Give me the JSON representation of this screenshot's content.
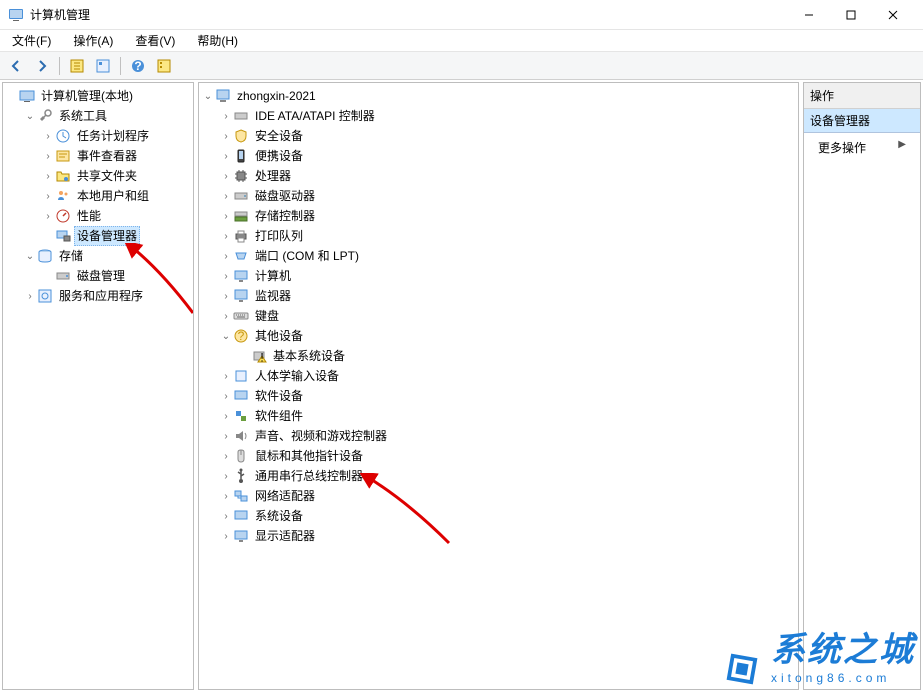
{
  "window": {
    "title": "计算机管理"
  },
  "menubar": {
    "file": "文件(F)",
    "action": "操作(A)",
    "view": "查看(V)",
    "help": "帮助(H)"
  },
  "left_tree": {
    "root": "计算机管理(本地)",
    "system_tools": "系统工具",
    "task_scheduler": "任务计划程序",
    "event_viewer": "事件查看器",
    "shared_folders": "共享文件夹",
    "local_users": "本地用户和组",
    "performance": "性能",
    "device_manager": "设备管理器",
    "storage": "存储",
    "disk_management": "磁盘管理",
    "services_apps": "服务和应用程序"
  },
  "device_tree": {
    "computer": "zhongxin-2021",
    "ide": "IDE ATA/ATAPI 控制器",
    "security": "安全设备",
    "portable": "便携设备",
    "processors": "处理器",
    "disk_drives": "磁盘驱动器",
    "storage_ctrl": "存储控制器",
    "print_queues": "打印队列",
    "ports": "端口 (COM 和 LPT)",
    "computers": "计算机",
    "monitors": "监视器",
    "keyboards": "键盘",
    "other_devices": "其他设备",
    "base_system": "基本系统设备",
    "hid": "人体学输入设备",
    "software_devices": "软件设备",
    "software_components": "软件组件",
    "sound": "声音、视频和游戏控制器",
    "mice": "鼠标和其他指针设备",
    "usb": "通用串行总线控制器",
    "network": "网络适配器",
    "system": "系统设备",
    "display": "显示适配器"
  },
  "right_panel": {
    "header": "操作",
    "section": "设备管理器",
    "more_actions": "更多操作"
  },
  "watermark": {
    "brand": "系统之城",
    "url": "xitong86.com"
  }
}
